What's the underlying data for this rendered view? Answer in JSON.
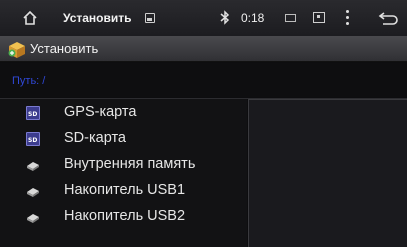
{
  "statusbar": {
    "title": "Установить",
    "time": "0:18",
    "bluetooth_symbol": "ʙ"
  },
  "appbar": {
    "title": "Установить",
    "icon": "installer-box-icon"
  },
  "path": {
    "text": "Путь: /"
  },
  "storage_items": [
    {
      "label": "GPS-карта",
      "icon": "sd-card-icon",
      "icon_text": "SD"
    },
    {
      "label": "SD-карта",
      "icon": "sd-card-icon",
      "icon_text": "SD"
    },
    {
      "label": "Внутренняя память",
      "icon": "drive-icon"
    },
    {
      "label": "Накопитель USB1",
      "icon": "drive-icon"
    },
    {
      "label": "Накопитель USB2",
      "icon": "drive-icon"
    }
  ],
  "colors": {
    "path_text": "#3048d8",
    "background": "#0d0d0f"
  }
}
